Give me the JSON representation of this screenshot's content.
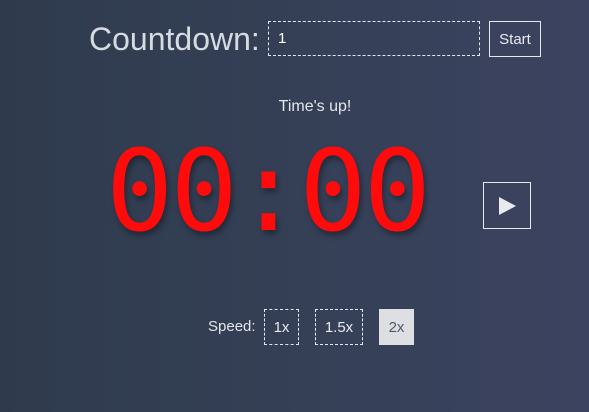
{
  "header": {
    "title": "Countdown:",
    "minutes_input_value": "1",
    "start_label": "Start"
  },
  "status": {
    "message": "Time's up!"
  },
  "timer": {
    "display": "00:00",
    "color": "#ff0b0b"
  },
  "controls": {
    "play_icon": "play-icon"
  },
  "speed": {
    "label": "Speed:",
    "options": [
      "1x",
      "1.5x",
      "2x"
    ],
    "selected": "2x"
  }
}
